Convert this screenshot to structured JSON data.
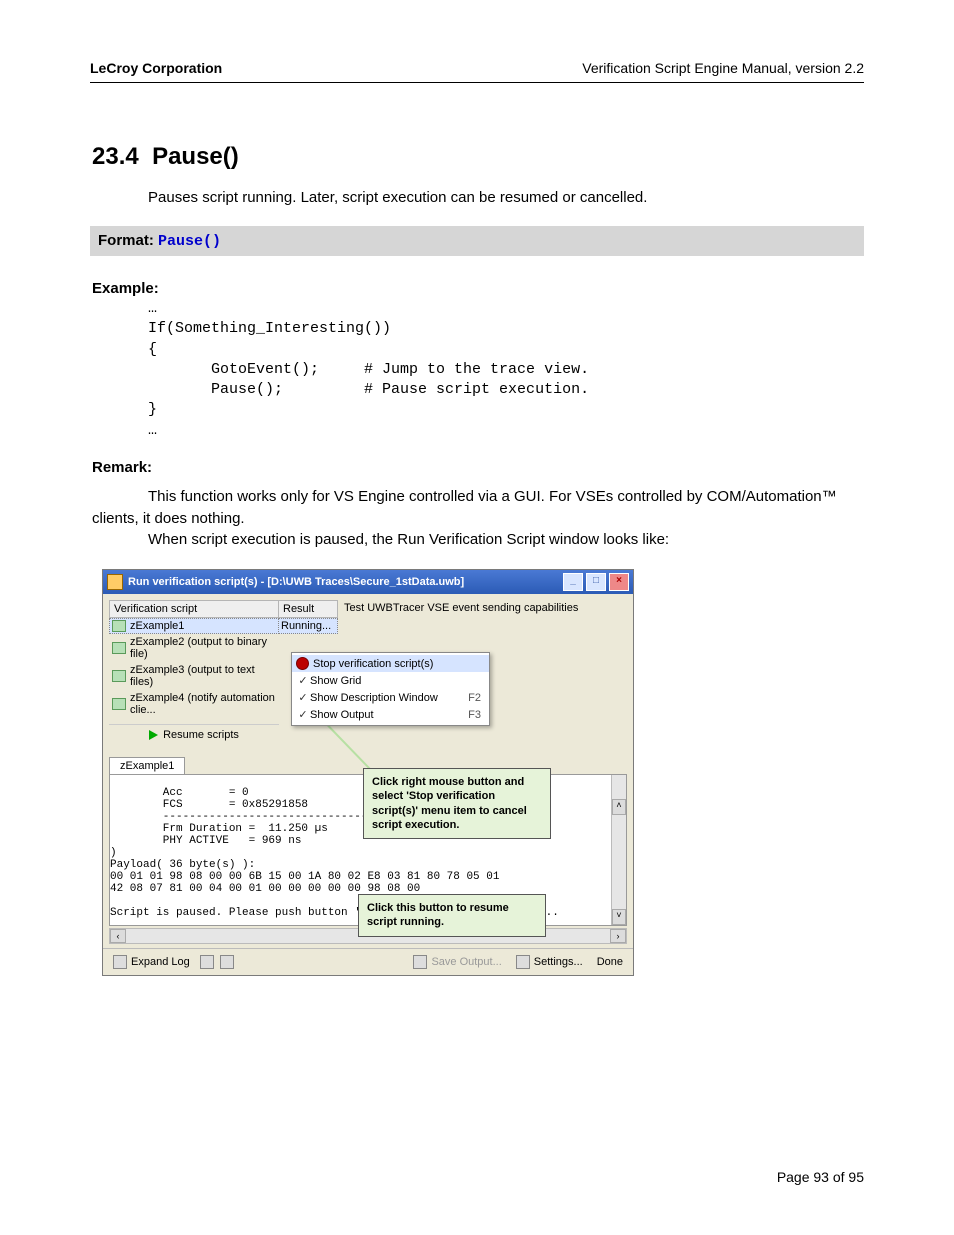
{
  "header": {
    "left": "LeCroy Corporation",
    "right": "Verification Script Engine Manual, version 2.2"
  },
  "section": {
    "number": "23.4",
    "name": "Pause()"
  },
  "description": "Pauses script running. Later, script execution can be resumed or cancelled.",
  "format": {
    "label": "Format:",
    "code": "Pause()"
  },
  "example": {
    "label": "Example:",
    "code": "…\nIf(Something_Interesting())\n{\n       GotoEvent();     # Jump to the trace view.\n       Pause();         # Pause script execution.\n}\n…"
  },
  "remark": {
    "label": "Remark:",
    "p1": "This function works only for VS Engine controlled via a GUI. For VSEs controlled by COM/Automation™ clients, it does nothing.",
    "p2": "When script execution is paused, the Run Verification Script window looks like:"
  },
  "shot": {
    "title": "Run verification script(s) - [D:\\UWB Traces\\Secure_1stData.uwb]",
    "min": "_",
    "max": "□",
    "close": "×",
    "col_script": "Verification script",
    "col_result": "Result",
    "scripts": [
      {
        "name": "zExample1",
        "result": "Running..."
      },
      {
        "name": "zExample2 (output to binary file)",
        "result": ""
      },
      {
        "name": "zExample3 (output to text files)",
        "result": ""
      },
      {
        "name": "zExample4 (notify automation clie...",
        "result": ""
      }
    ],
    "right_header": "Test UWBTracer VSE event sending capabilities",
    "ctx": {
      "stop": "Stop verification script(s)",
      "grid": "Show Grid",
      "desc": "Show Description Window",
      "desc_acc": "F2",
      "out": "Show Output",
      "out_acc": "F3"
    },
    "resume_btn": "Resume scripts",
    "callout1": "Click right mouse button and select 'Stop verification script(s)' menu item to cancel script execution.",
    "callout2": "Click this button to resume script running.",
    "tab": "zExample1",
    "log": "        Acc       = 0\n        FCS       = 0x85291858\n        -------------------------------\n        Frm Duration =  11.250 µs\n        PHY ACTIVE   = 969 ns\n)\nPayload( 36 byte(s) ):\n00 01 01 98 08 00 00 6B 15 00 1A 80 02 E8 03 81 80 78 05 01\n42 08 07 81 00 04 00 01 00 00 00 00 00 98 08 00\n\nScript is paused. Please push button 'Resume scripts' to continue...",
    "bottom": {
      "expand": "Expand Log",
      "save": "Save Output...",
      "settings": "Settings...",
      "done": "Done"
    }
  },
  "footer": "Page 93 of 95"
}
